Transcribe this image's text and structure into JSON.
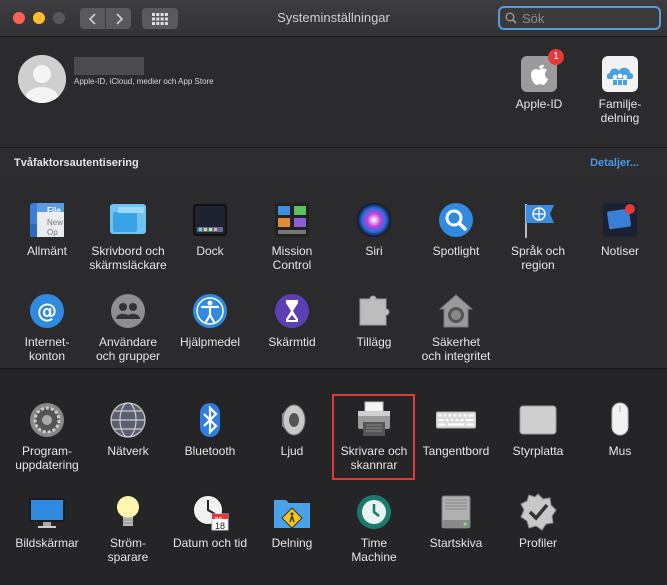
{
  "window": {
    "title": "Systeminställningar"
  },
  "search": {
    "placeholder": "Sök"
  },
  "account": {
    "subtitle": "Apple-ID, iCloud, medier och App Store"
  },
  "top_items": [
    {
      "label": "Apple-ID",
      "badge": "1"
    },
    {
      "label": "Familje-\ndelning"
    }
  ],
  "twofa": {
    "label": "Tvåfaktorsautentisering",
    "link": "Detaljer..."
  },
  "row1": [
    "Allmänt",
    "Skrivbord och skärmsläckare",
    "Dock",
    "Mission Control",
    "Siri",
    "Spotlight",
    "Språk och region",
    "Notiser"
  ],
  "row2": [
    "Internet-konton",
    "Användare och grupper",
    "Hjälpmedel",
    "Skärmtid",
    "Tillägg",
    "Säkerhet och integritet"
  ],
  "row3": [
    "Program-uppdatering",
    "Nätverk",
    "Bluetooth",
    "Ljud",
    "Skrivare och skannrar",
    "Tangentbord",
    "Styrplatta",
    "Mus"
  ],
  "row4": [
    "Bildskärmar",
    "Ström-sparare",
    "Datum och tid",
    "Delning",
    "Time Machine",
    "Startskiva",
    "Profiler"
  ],
  "labels": {
    "allmant": "Allmänt",
    "skrivbord": "Skrivbord och\nskärmsläckare",
    "dock": "Dock",
    "mission": "Mission\nControl",
    "siri": "Siri",
    "spotlight": "Spotlight",
    "sprak": "Språk och\nregion",
    "notiser": "Notiser",
    "internet": "Internet-\nkonton",
    "anvandare": "Användare\noch grupper",
    "hjalp": "Hjälpmedel",
    "skarmtid": "Skärmtid",
    "tillagg": "Tillägg",
    "sakerhet": "Säkerhet\noch integritet",
    "program": "Program-\nuppdatering",
    "natverk": "Nätverk",
    "bluetooth": "Bluetooth",
    "ljud": "Ljud",
    "skrivare": "Skrivare och\nskannrar",
    "tangent": "Tangentbord",
    "styr": "Styrplatta",
    "mus": "Mus",
    "bild": "Bildskärmar",
    "strom": "Ström-\nsparare",
    "datum": "Datum och tid",
    "delning": "Delning",
    "time": "Time\nMachine",
    "start": "Startskiva",
    "profiler": "Profiler"
  },
  "icon_texts": {
    "file_top": "File",
    "file_mid": "New",
    "file_bot": "Op",
    "cal_month": "JUL",
    "cal_day": "18"
  },
  "colors": {
    "accent": "#4a98e8",
    "highlight": "#e03a3a",
    "badge": "#e8383a"
  }
}
